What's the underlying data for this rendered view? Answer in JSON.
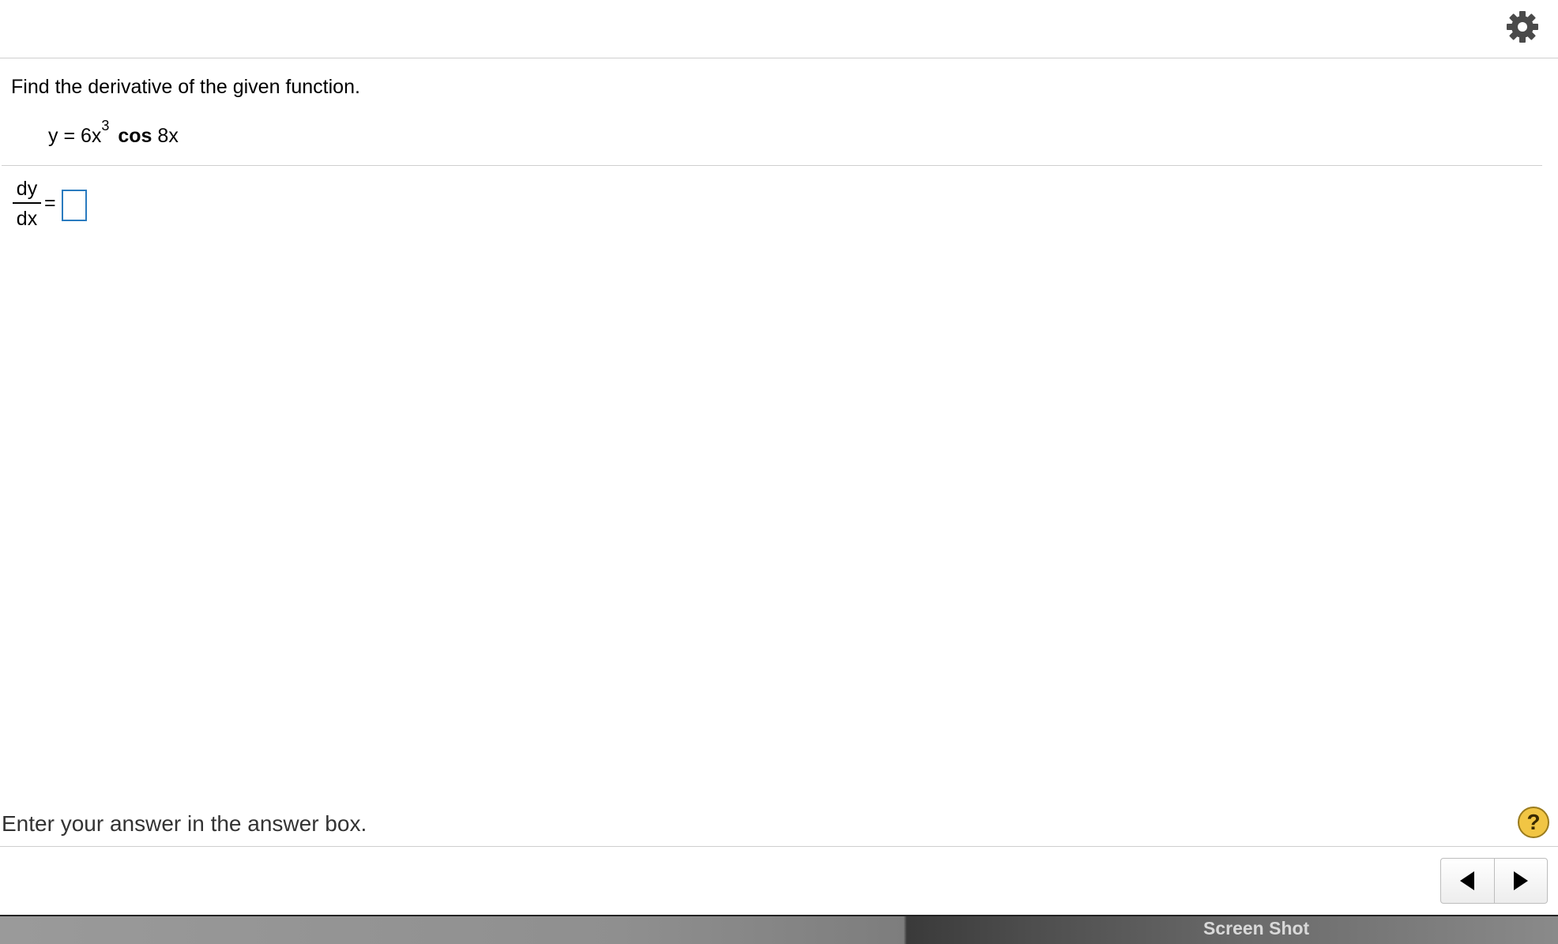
{
  "header": {
    "settings_icon": "gear-icon"
  },
  "question": {
    "prompt": "Find the derivative of the given function.",
    "function": {
      "lhs": "y = 6x",
      "exponent": "3",
      "func_name": "cos",
      "argument": "8x"
    }
  },
  "answer": {
    "numerator": "dy",
    "denominator": "dx",
    "equals": "=",
    "value": ""
  },
  "status": {
    "instruction": "Enter your answer in the answer box.",
    "help_label": "?"
  },
  "navigation": {
    "prev_icon": "triangle-left-icon",
    "next_icon": "triangle-right-icon"
  },
  "desktop": {
    "label": "Screen Shot"
  },
  "colors": {
    "answer_box_border": "#2a7bbf",
    "help_button": "#f1c544",
    "divider": "#cfcfcf"
  }
}
